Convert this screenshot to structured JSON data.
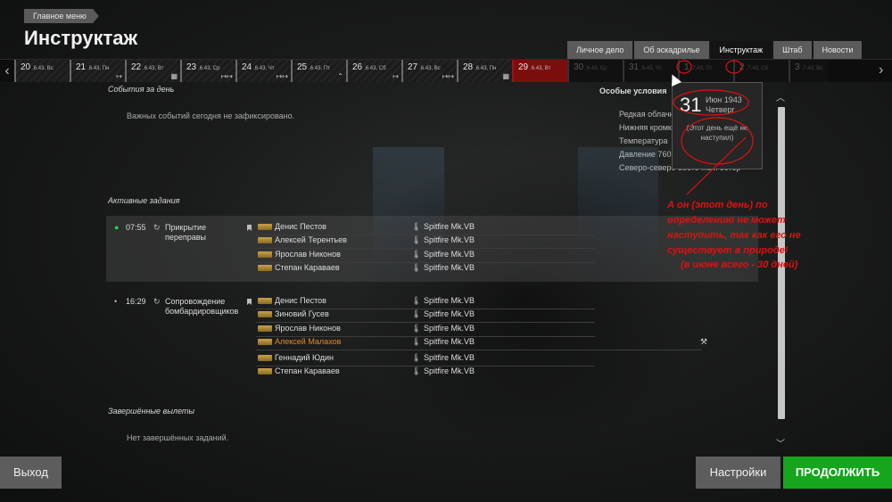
{
  "breadcrumb": "Главное меню",
  "title": "Инструктаж",
  "tabs": [
    {
      "label": "Личное дело",
      "active": false
    },
    {
      "label": "Об эскадрилье",
      "active": false
    },
    {
      "label": "Инструктаж",
      "active": true
    },
    {
      "label": "Штаб",
      "active": false
    },
    {
      "label": "Новости",
      "active": false
    }
  ],
  "days": [
    {
      "num": "20",
      "sub": ".6.43, Вс"
    },
    {
      "num": "21",
      "sub": ".6.43, Пн"
    },
    {
      "num": "22",
      "sub": ".6.43, Вт"
    },
    {
      "num": "23",
      "sub": ".6.43, Ср"
    },
    {
      "num": "24",
      "sub": ".6.43, Чт"
    },
    {
      "num": "25",
      "sub": ".6.43, Пт"
    },
    {
      "num": "26",
      "sub": ".6.43, Сб"
    },
    {
      "num": "27",
      "sub": ".6.43, Вс"
    },
    {
      "num": "28",
      "sub": ".6.43, Пн"
    },
    {
      "num": "29",
      "sub": ".6.43, Вт"
    },
    {
      "num": "30",
      "sub": ".6.43, Ср"
    },
    {
      "num": "31",
      "sub": ".6.43, Чт"
    },
    {
      "num": "1",
      "sub": ".7.43, Пт"
    },
    {
      "num": "2",
      "sub": ".7.43, Сб"
    },
    {
      "num": "3",
      "sub": ".7.43, Вс"
    }
  ],
  "tooltip": {
    "day": "31",
    "month": "Июн 1943",
    "weekday": "Четверг",
    "note": "(Этот день ещё не наступил)"
  },
  "annotation": {
    "lines": [
      "А он (этот день) по",
      "определению не может",
      "наступить, так как его не",
      "существует в природе!",
      "(в июне всего - 30 дней)"
    ],
    "color": "#e01010"
  },
  "events": {
    "header": "События за день",
    "text": "Важных событий сегодня не зафиксировано."
  },
  "weather": {
    "header": "Особые условия",
    "lines": [
      "Редкая облачность",
      "Нижняя кромка",
      "Температура",
      "Давление 760",
      "Северо-северо-восточный ветер"
    ]
  },
  "active_header": "Активные задания",
  "missions": [
    {
      "time": "07:55",
      "name": "Прикрытие переправы",
      "crew": [
        {
          "pilot": "Денис Пестов",
          "plane": "Spitfire Mk.VB"
        },
        {
          "pilot": "Алексей Терентьев",
          "plane": "Spitfire Mk.VB"
        },
        {
          "pilot": "Ярослав Никонов",
          "plane": "Spitfire Mk.VB"
        },
        {
          "pilot": "Степан Караваев",
          "plane": "Spitfire Mk.VB"
        }
      ]
    },
    {
      "time": "16:29",
      "name": "Сопровождение бомбардировщиков",
      "crew": [
        {
          "pilot": "Денис Пестов",
          "plane": "Spitfire Mk.VB"
        },
        {
          "pilot": "Зиновий Гусев",
          "plane": "Spitfire Mk.VB"
        },
        {
          "pilot": "Ярослав Никонов",
          "plane": "Spitfire Mk.VB"
        },
        {
          "pilot": "Алексей Малахов",
          "plane": "Spitfire Mk.VB"
        },
        {
          "pilot": "Геннадий Юдин",
          "plane": "Spitfire Mk.VB"
        },
        {
          "pilot": "Степан Караваев",
          "plane": "Spitfire Mk.VB"
        }
      ]
    }
  ],
  "completed": {
    "header": "Завершённые вылеты",
    "text": "Нет завершённых заданий."
  },
  "buttons": {
    "exit": "Выход",
    "settings": "Настройки",
    "continue": "ПРОДОЛЖИТЬ"
  },
  "colors": {
    "accent_green": "#15a61e",
    "current_day": "#7c0d0d",
    "highlight_pilot": "#e0882a"
  }
}
